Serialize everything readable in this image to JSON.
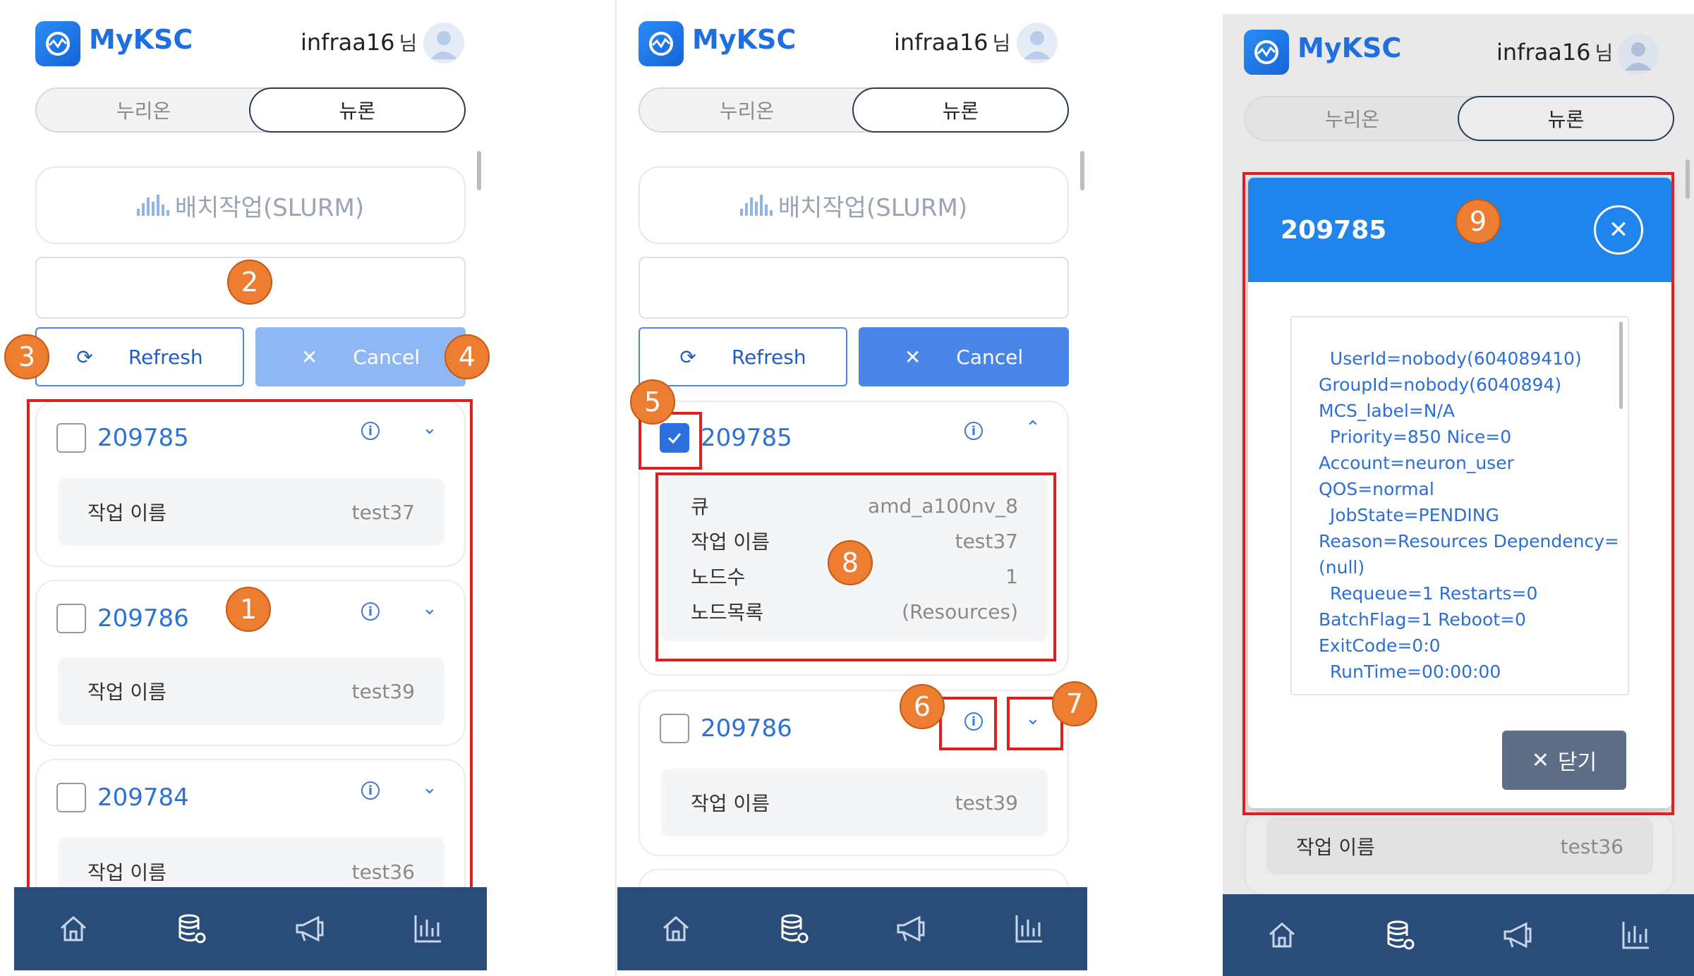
{
  "app": {
    "name": "MyKSC",
    "user_name": "infraa16",
    "user_suffix": "님"
  },
  "tabs": {
    "tab1": "누리온",
    "tab2": "뉴론",
    "active": "뉴론"
  },
  "slurm_card": {
    "label": "배치작업(SLURM)"
  },
  "buttons": {
    "refresh": "Refresh",
    "cancel": "Cancel",
    "close": "닫기"
  },
  "labels": {
    "job_name": "작업 이름",
    "queue": "큐",
    "node_count": "노드수",
    "node_list": "노드목록"
  },
  "jobs": [
    {
      "id": "209785",
      "job_name": "test37",
      "queue": "amd_a100nv_8",
      "node_count": "1",
      "node_list": "(Resources)"
    },
    {
      "id": "209786",
      "job_name": "test39"
    },
    {
      "id": "209784",
      "job_name": "test36"
    }
  ],
  "markers": [
    "1",
    "2",
    "3",
    "4",
    "5",
    "6",
    "7",
    "8",
    "9"
  ],
  "modal": {
    "title": "209785",
    "lines": [
      "  UserId=nobody(604089410)",
      "GroupId=nobody(6040894)",
      "MCS_label=N/A",
      "  Priority=850 Nice=0",
      "Account=neuron_user",
      "QOS=normal",
      "  JobState=PENDING",
      "Reason=Resources Dependency=",
      "(null)",
      "  Requeue=1 Restarts=0",
      "BatchFlag=1 Reboot=0",
      "ExitCode=0:0",
      "  RunTime=00:00:00"
    ]
  },
  "nav": [
    "home-icon",
    "database-settings-icon",
    "megaphone-icon",
    "bar-chart-icon"
  ],
  "colors": {
    "accent": "#2b72d8",
    "marker": "#ec7d31",
    "highlight": "#e02020",
    "nav_bg": "#2a4c78",
    "modal_header": "#1f84ec"
  }
}
